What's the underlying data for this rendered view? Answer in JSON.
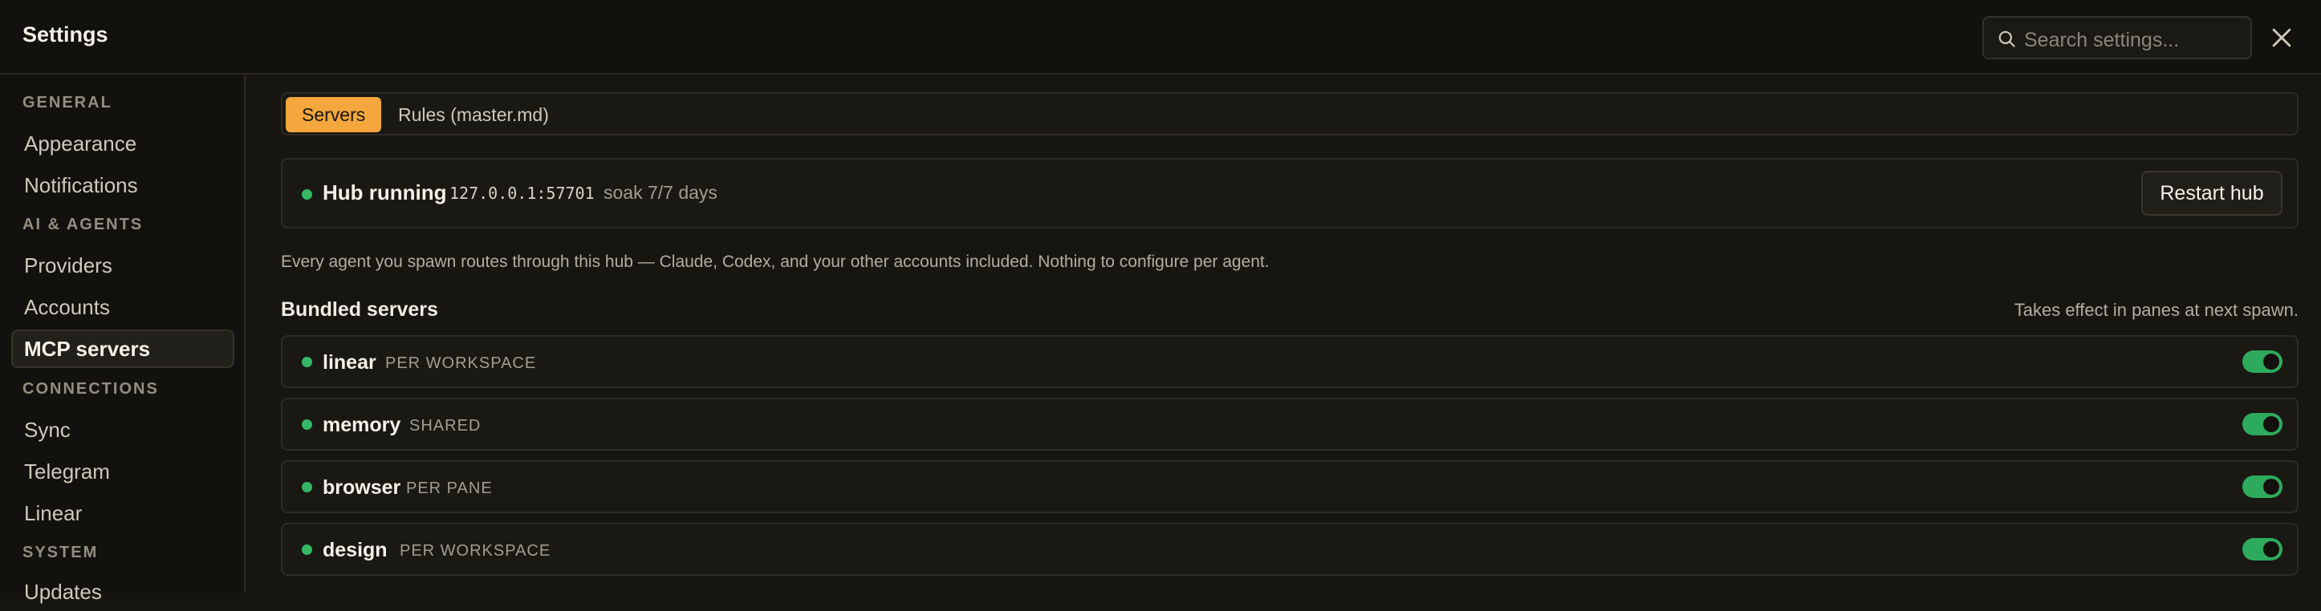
{
  "header": {
    "title": "Settings",
    "search_placeholder": "Search settings..."
  },
  "sidebar": {
    "sections": [
      {
        "label": "GENERAL",
        "items": [
          "Appearance",
          "Notifications"
        ]
      },
      {
        "label": "AI & AGENTS",
        "items": [
          "Providers",
          "Accounts",
          "MCP servers"
        ]
      },
      {
        "label": "CONNECTIONS",
        "items": [
          "Sync",
          "Telegram",
          "Linear"
        ]
      },
      {
        "label": "SYSTEM",
        "items": [
          "Updates"
        ]
      }
    ],
    "active_item": "MCP servers"
  },
  "tabs": [
    {
      "label": "Servers",
      "active": true
    },
    {
      "label": "Rules (master.md)",
      "active": false
    }
  ],
  "hub": {
    "status": "Hub running",
    "address": "127.0.0.1:57701",
    "soak": "soak 7/7 days",
    "restart_label": "Restart hub",
    "status_color": "#35b865"
  },
  "info_text": "Every agent you spawn routes through this hub — Claude, Codex, and your other accounts included. Nothing to configure per agent.",
  "bundled": {
    "title": "Bundled servers",
    "note": "Takes effect in panes at next spawn.",
    "servers": [
      {
        "name": "linear",
        "scope": "PER WORKSPACE",
        "enabled": true
      },
      {
        "name": "memory",
        "scope": "SHARED",
        "enabled": true
      },
      {
        "name": "browser",
        "scope": "PER PANE",
        "enabled": true
      },
      {
        "name": "design",
        "scope": "PER WORKSPACE",
        "enabled": true
      }
    ]
  },
  "colors": {
    "accent": "#f3a73c",
    "toggle_on": "#2eaa5c"
  }
}
